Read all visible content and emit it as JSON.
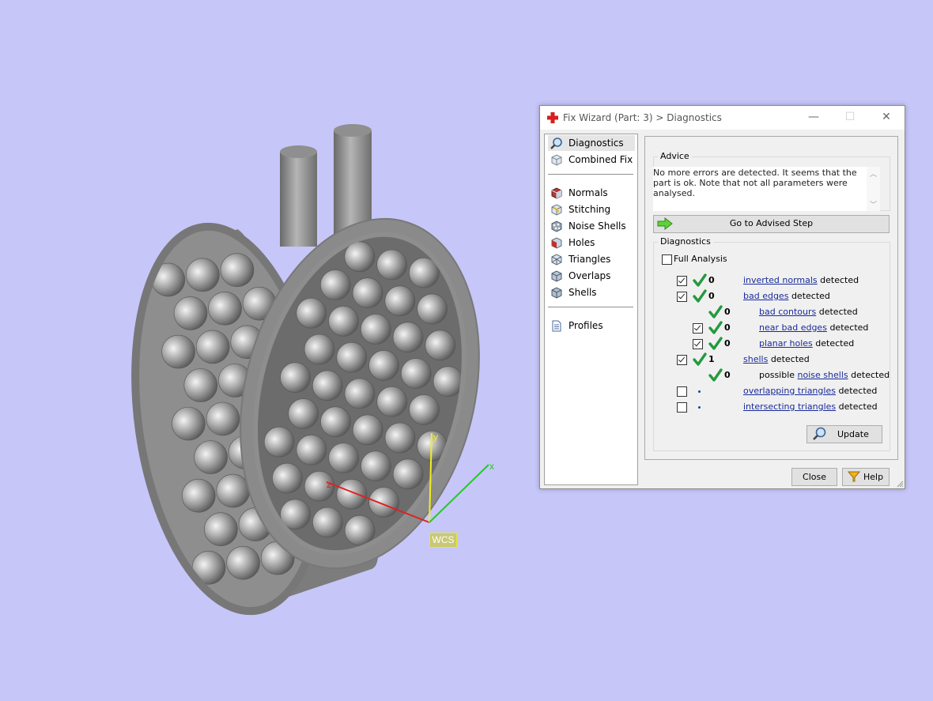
{
  "viewport": {
    "background": "#c6c6f9",
    "wcs_label": "WCS",
    "axis_labels": {
      "x": "x",
      "y": "y",
      "z": "z"
    },
    "axis_colors": {
      "x": "#22cc22",
      "y": "#eeee22",
      "z": "#dd2222"
    }
  },
  "dialog": {
    "title": "Fix Wizard (Part: 3) > Diagnostics",
    "title_icon": "red-cross-icon",
    "window_controls": {
      "minimize": "—",
      "maximize": "☐",
      "close": "✕"
    },
    "nav": {
      "items": [
        {
          "label": "Diagnostics",
          "icon": "magnifier-icon",
          "selected": true
        },
        {
          "label": "Combined Fix",
          "icon": "cube-icon"
        },
        {
          "label": "Normals",
          "icon": "normals-cube-icon"
        },
        {
          "label": "Stitching",
          "icon": "stitching-cube-icon"
        },
        {
          "label": "Noise Shells",
          "icon": "noise-shells-icon"
        },
        {
          "label": "Holes",
          "icon": "holes-cube-icon"
        },
        {
          "label": "Triangles",
          "icon": "triangles-cube-icon"
        },
        {
          "label": "Overlaps",
          "icon": "overlaps-cube-icon"
        },
        {
          "label": "Shells",
          "icon": "shells-cube-icon"
        },
        {
          "label": "Profiles",
          "icon": "document-icon"
        }
      ]
    },
    "advice": {
      "title": "Advice",
      "text": "No more errors are detected. It seems that the part is ok. Note that not all parameters were analysed."
    },
    "goto_button": "Go to Advised Step",
    "diagnostics": {
      "title": "Diagnostics",
      "full_analysis_label": "Full Analysis",
      "full_analysis_checked": false,
      "rows": [
        {
          "checked": true,
          "status": "ok",
          "count": "0",
          "prefix": "",
          "link": "inverted normals",
          "suffix": "detected"
        },
        {
          "checked": true,
          "status": "ok",
          "count": "0",
          "prefix": "",
          "link": "bad edges",
          "suffix": "detected"
        },
        {
          "checked": null,
          "status": "ok",
          "count": "0",
          "prefix": "",
          "link": "bad contours",
          "suffix": "detected"
        },
        {
          "checked": true,
          "status": "ok",
          "count": "0",
          "prefix": "",
          "link": "near bad edges",
          "suffix": "detected"
        },
        {
          "checked": true,
          "status": "ok",
          "count": "0",
          "prefix": "",
          "link": "planar holes",
          "suffix": "detected"
        },
        {
          "checked": true,
          "status": "ok",
          "count": "1",
          "prefix": "",
          "link": "shells",
          "suffix": "detected"
        },
        {
          "checked": null,
          "status": "ok",
          "count": "0",
          "prefix": "possible",
          "link": "noise shells",
          "suffix": "detected"
        },
        {
          "checked": false,
          "status": "unknown",
          "count": "",
          "prefix": "",
          "link": "overlapping triangles",
          "suffix": "detected"
        },
        {
          "checked": false,
          "status": "unknown",
          "count": "",
          "prefix": "",
          "link": "intersecting triangles",
          "suffix": "detected"
        }
      ],
      "update_button": "Update"
    },
    "close_button": "Close",
    "help_button": "Help"
  }
}
